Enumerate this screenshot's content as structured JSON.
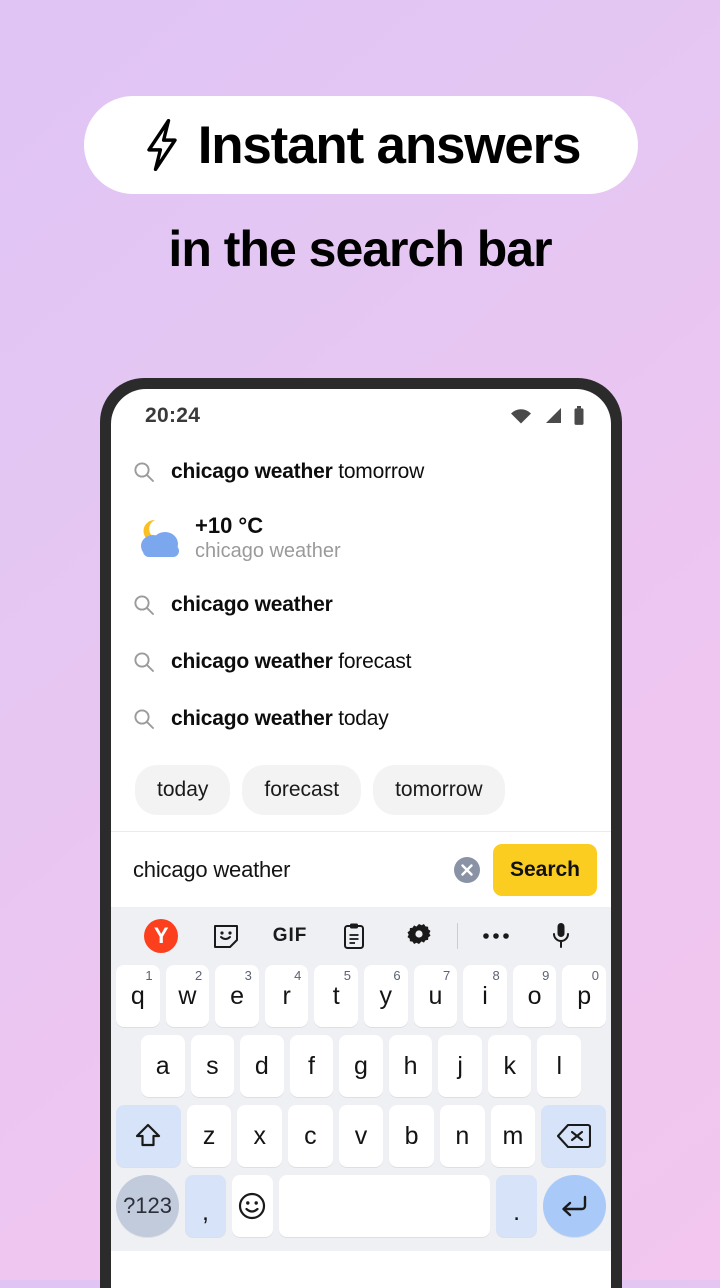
{
  "promo": {
    "headline": "Instant answers",
    "subtitle": "in the search bar",
    "bolt_icon": "lightning-bolt-icon",
    "colors": {
      "pill_bg": "#ffffff",
      "text": "#000000",
      "bg_start": "#dfc4f4",
      "bg_end": "#f2c6ee"
    }
  },
  "phone": {
    "status": {
      "time": "20:24",
      "icons": [
        "wifi-icon",
        "cellular-signal-icon",
        "battery-icon"
      ]
    },
    "suggestions": [
      {
        "icon": "search-icon",
        "bold": "chicago weather",
        "rest": " tomorrow"
      },
      {
        "icon": "search-icon",
        "bold": "chicago weather",
        "rest": ""
      },
      {
        "icon": "search-icon",
        "bold": "chicago weather",
        "rest": " forecast"
      },
      {
        "icon": "search-icon",
        "bold": "chicago weather",
        "rest": " today"
      }
    ],
    "weather": {
      "icon": "moon-cloud-icon",
      "temperature": "+10 °C",
      "query": "chicago weather",
      "icon_colors": {
        "moon": "#fbbf24",
        "cloud": "#7ba7ef"
      }
    },
    "chips": [
      "today",
      "forecast",
      "tomorrow"
    ],
    "search": {
      "value": "chicago weather",
      "placeholder": "Search",
      "clear_icon": "clear-circle-icon",
      "button_label": "Search",
      "button_color": "#fccd21"
    },
    "keyboard": {
      "toolbar": [
        "yandex-logo-icon",
        "sticker-icon",
        "gif-icon",
        "clipboard-icon",
        "gear-icon",
        "divider",
        "more-options-icon",
        "microphone-icon"
      ],
      "yandex_letter": "Y",
      "gif_label": "GIF",
      "row1": [
        {
          "k": "q",
          "n": "1"
        },
        {
          "k": "w",
          "n": "2"
        },
        {
          "k": "e",
          "n": "3"
        },
        {
          "k": "r",
          "n": "4"
        },
        {
          "k": "t",
          "n": "5"
        },
        {
          "k": "y",
          "n": "6"
        },
        {
          "k": "u",
          "n": "7"
        },
        {
          "k": "i",
          "n": "8"
        },
        {
          "k": "o",
          "n": "9"
        },
        {
          "k": "p",
          "n": "0"
        }
      ],
      "row2": [
        "a",
        "s",
        "d",
        "f",
        "g",
        "h",
        "j",
        "k",
        "l"
      ],
      "row3": [
        "z",
        "x",
        "c",
        "v",
        "b",
        "n",
        "m"
      ],
      "shift_icon": "shift-arrow-icon",
      "backspace_icon": "backspace-icon",
      "num_label": "?123",
      "comma_label": ",",
      "emoji_icon": "emoji-smiley-icon",
      "space_label": "",
      "period_label": ".",
      "enter_icon": "enter-arrow-icon"
    }
  }
}
